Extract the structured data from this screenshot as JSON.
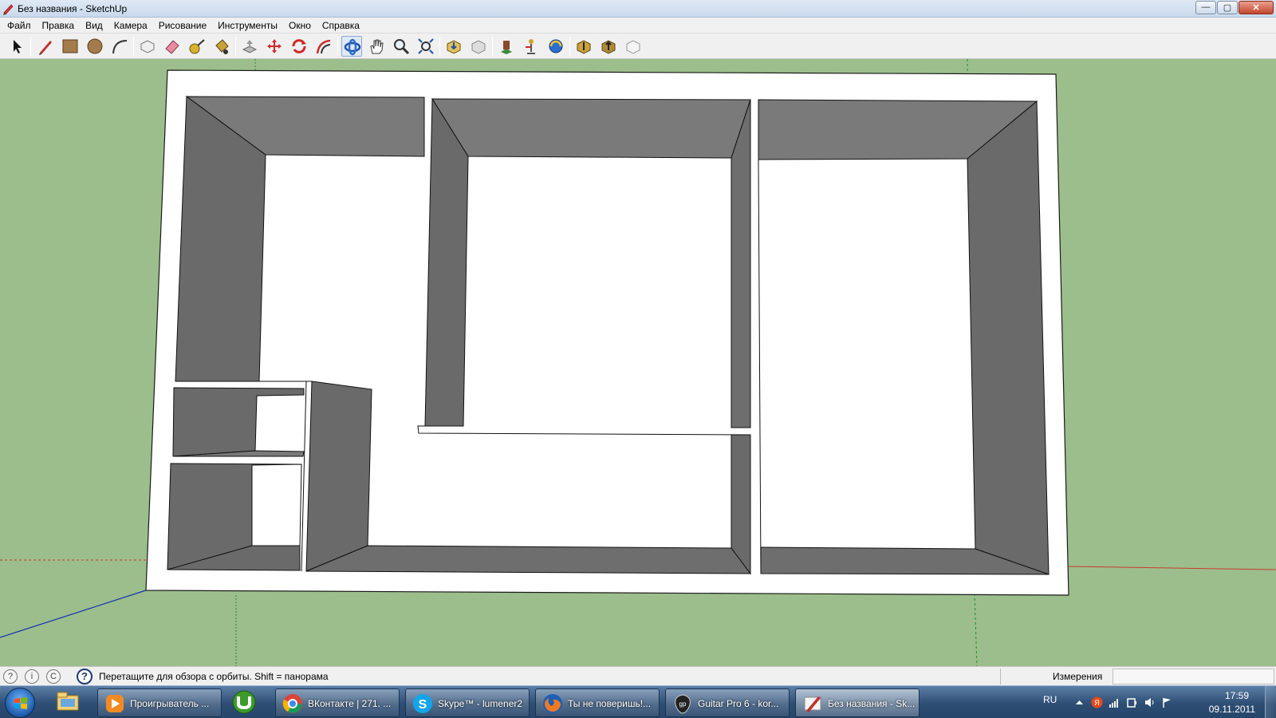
{
  "window": {
    "title": "Без названия - SketchUp",
    "controls": {
      "minimize": "—",
      "maximize": "▢",
      "close": "✕"
    }
  },
  "menu": [
    "Файл",
    "Правка",
    "Вид",
    "Камера",
    "Рисование",
    "Инструменты",
    "Окно",
    "Справка"
  ],
  "toolbar": {
    "tools": [
      "select-tool",
      "pencil-line-tool",
      "rectangle-tool",
      "circle-tool",
      "arc-tool",
      "make-component-tool",
      "eraser-tool",
      "tape-measure-tool",
      "paint-bucket-tool",
      "push-pull-tool",
      "move-tool",
      "rotate-tool",
      "offset-tool",
      "orbit-tool",
      "pan-tool",
      "zoom-tool",
      "zoom-extents-tool",
      "get-models-tool",
      "share-model-tool",
      "get-photo-texture-tool",
      "position-camera-tool",
      "look-around-tool",
      "walk-tool",
      "components-tool",
      "styles-tool"
    ],
    "active_tool": "orbit-tool"
  },
  "colors": {
    "ground": "#9cbe8c",
    "wall_face": "#6e6e6e",
    "wall_face_light": "#7a7a7a",
    "floor": "#ffffff",
    "axis_red": "#c83c2c",
    "axis_blue": "#1a2fb4",
    "axis_green": "#1f8a30"
  },
  "status": {
    "hint": "Перетащите для обзора с орбиты.  Shift = панорама",
    "measurements_label": "Измерения",
    "measurements_value": ""
  },
  "taskbar": {
    "items": [
      {
        "label": "Проигрыватель ...",
        "icon": "media-player-icon"
      },
      {
        "label": "ВКонтакте | 271. ...",
        "icon": "chrome-icon"
      },
      {
        "label": "Skype™ - lumener2",
        "icon": "skype-icon"
      },
      {
        "label": "Ты не поверишь!...",
        "icon": "firefox-icon"
      },
      {
        "label": "Guitar Pro 6 - kor...",
        "icon": "guitar-pro-icon"
      },
      {
        "label": "Без названия - Sk...",
        "icon": "sketchup-icon"
      }
    ],
    "pinned": [
      "explorer-icon",
      "utorrent-icon"
    ],
    "language": "RU",
    "time": "17:59",
    "date": "09.11.2011"
  }
}
